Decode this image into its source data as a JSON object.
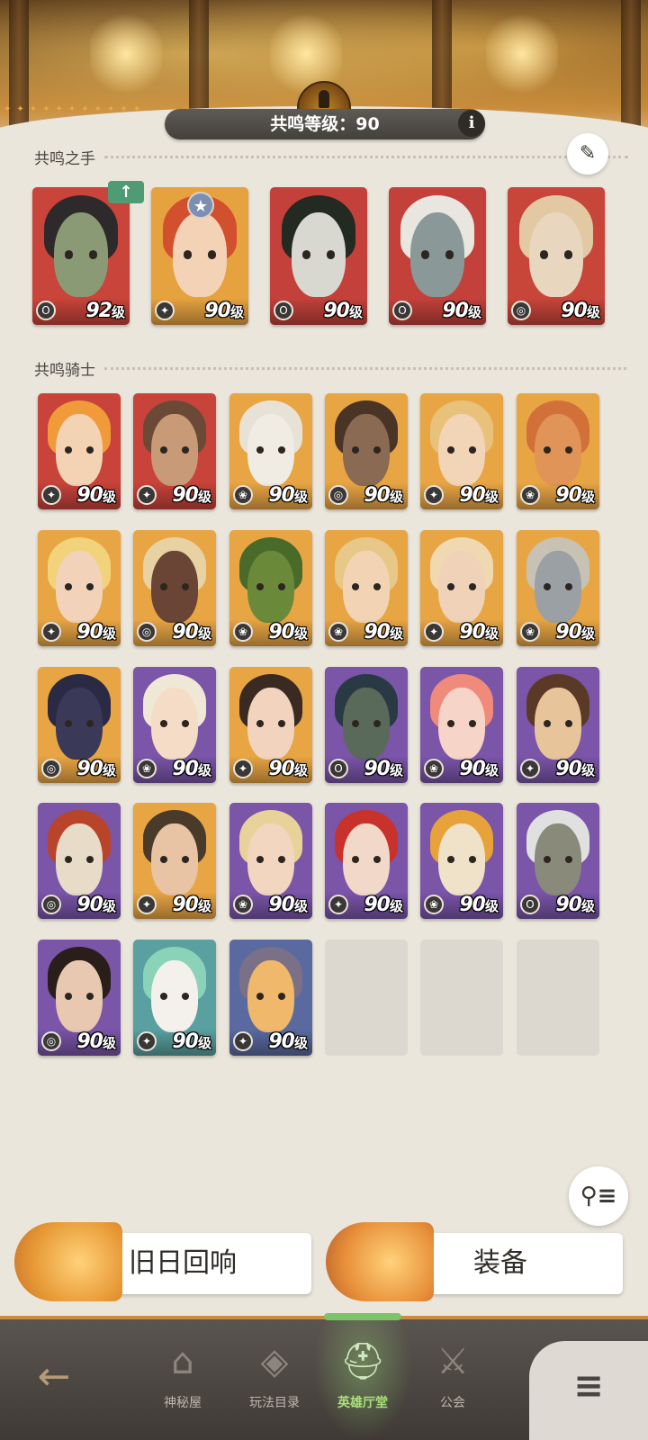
{
  "header": {
    "level_label": "共鸣等级：90",
    "info_label": "i"
  },
  "sections": {
    "hands_title": "共鸣之手",
    "knights_title": "共鸣骑士"
  },
  "hands": [
    {
      "level": "92",
      "unit": "级",
      "class": "O",
      "bg": "#c9443a",
      "hair": "#2e2a2c",
      "face": "#8a9a74"
    },
    {
      "level": "90",
      "unit": "级",
      "class": "✦",
      "bg": "#e6a23f",
      "hair": "#d2502d",
      "face": "#f3d2b6"
    },
    {
      "level": "90",
      "unit": "级",
      "class": "O",
      "bg": "#c3413a",
      "hair": "#222a22",
      "face": "#d8d8d0"
    },
    {
      "level": "90",
      "unit": "级",
      "class": "O",
      "bg": "#c3413a",
      "hair": "#e8e6df",
      "face": "#8a9998"
    },
    {
      "level": "90",
      "unit": "级",
      "class": "◎",
      "bg": "#c8453a",
      "hair": "#e2c9a3",
      "face": "#e8d6bf"
    }
  ],
  "knights": [
    {
      "level": "90",
      "unit": "级",
      "class": "✦",
      "bg": "#c8433a",
      "hair": "#f09a3a",
      "face": "#f4d3b5"
    },
    {
      "level": "90",
      "unit": "级",
      "class": "✦",
      "bg": "#c8433a",
      "hair": "#6a4a36",
      "face": "#c89a78"
    },
    {
      "level": "90",
      "unit": "级",
      "class": "❀",
      "bg": "#e8a544",
      "hair": "#e8e2d6",
      "face": "#f0ece4"
    },
    {
      "level": "90",
      "unit": "级",
      "class": "◎",
      "bg": "#e8a544",
      "hair": "#4a3426",
      "face": "#8a6a52"
    },
    {
      "level": "90",
      "unit": "级",
      "class": "✦",
      "bg": "#e8a544",
      "hair": "#e8c27a",
      "face": "#f2d4b6"
    },
    {
      "level": "90",
      "unit": "级",
      "class": "❀",
      "bg": "#e8a544",
      "hair": "#d2703a",
      "face": "#e09458"
    },
    {
      "level": "90",
      "unit": "级",
      "class": "✦",
      "bg": "#e8a544",
      "hair": "#f2d27a",
      "face": "#f2d2b8"
    },
    {
      "level": "90",
      "unit": "级",
      "class": "◎",
      "bg": "#e8a544",
      "hair": "#e8d2a4",
      "face": "#6a4434"
    },
    {
      "level": "90",
      "unit": "级",
      "class": "❀",
      "bg": "#e8a544",
      "hair": "#4a6a2a",
      "face": "#6a8a3a"
    },
    {
      "level": "90",
      "unit": "级",
      "class": "❀",
      "bg": "#e8a544",
      "hair": "#e8c888",
      "face": "#f2d4b4"
    },
    {
      "level": "90",
      "unit": "级",
      "class": "✦",
      "bg": "#e8a544",
      "hair": "#f0d8b0",
      "face": "#f0d2b8"
    },
    {
      "level": "90",
      "unit": "级",
      "class": "❀",
      "bg": "#e8a544",
      "hair": "#c8c2b4",
      "face": "#9aa0a4"
    },
    {
      "level": "90",
      "unit": "级",
      "class": "◎",
      "bg": "#e8a544",
      "hair": "#2a2a44",
      "face": "#3a3a58"
    },
    {
      "level": "90",
      "unit": "级",
      "class": "❀",
      "bg": "#7a55a8",
      "hair": "#f0e8d6",
      "face": "#f4dcc6"
    },
    {
      "level": "90",
      "unit": "级",
      "class": "✦",
      "bg": "#e8a544",
      "hair": "#3a2a22",
      "face": "#f2d4be"
    },
    {
      "level": "90",
      "unit": "级",
      "class": "O",
      "bg": "#7a55a8",
      "hair": "#2a3a44",
      "face": "#5a6a5a"
    },
    {
      "level": "90",
      "unit": "级",
      "class": "❀",
      "bg": "#7a55a8",
      "hair": "#f08a7a",
      "face": "#f6d4c8"
    },
    {
      "level": "90",
      "unit": "级",
      "class": "✦",
      "bg": "#7a55a8",
      "hair": "#5a3a26",
      "face": "#e8c49a"
    },
    {
      "level": "90",
      "unit": "级",
      "class": "◎",
      "bg": "#7a55a8",
      "hair": "#b8442a",
      "face": "#e8dcc8"
    },
    {
      "level": "90",
      "unit": "级",
      "class": "✦",
      "bg": "#e8a544",
      "hair": "#4a3a2a",
      "face": "#e8c4a4"
    },
    {
      "level": "90",
      "unit": "级",
      "class": "❀",
      "bg": "#7a55a8",
      "hair": "#e8d29a",
      "face": "#f2d6c0"
    },
    {
      "level": "90",
      "unit": "级",
      "class": "✦",
      "bg": "#7a55a8",
      "hair": "#c8322a",
      "face": "#f2d8c8"
    },
    {
      "level": "90",
      "unit": "级",
      "class": "❀",
      "bg": "#7a55a8",
      "hair": "#e8a23a",
      "face": "#f0e2c8"
    },
    {
      "level": "90",
      "unit": "级",
      "class": "O",
      "bg": "#7a55a8",
      "hair": "#e0e0e0",
      "face": "#8a8a7a"
    },
    {
      "level": "90",
      "unit": "级",
      "class": "◎",
      "bg": "#7a55a8",
      "hair": "#2a1e1a",
      "face": "#e8c8b0"
    },
    {
      "level": "90",
      "unit": "级",
      "class": "✦",
      "bg": "#5aa0a0",
      "hair": "#8ad2b8",
      "face": "#f4f0ec"
    },
    {
      "level": "90",
      "unit": "级",
      "class": "✦",
      "bg": "#5a6aa0",
      "hair": "#7a7088",
      "face": "#f0b86a"
    }
  ],
  "empty_slots": 3,
  "actions": {
    "echo_label": "旧日回响",
    "equip_label": "装备"
  },
  "nav": {
    "mystery_label": "神秘屋",
    "play_label": "玩法目录",
    "hero_label": "英雄厅堂",
    "guild_label": "公会"
  },
  "icons": {
    "info": "info-icon",
    "edit": "quill-pen-icon",
    "filter": "filter-icon",
    "back": "back-arrow-icon",
    "menu": "menu-list-icon"
  }
}
